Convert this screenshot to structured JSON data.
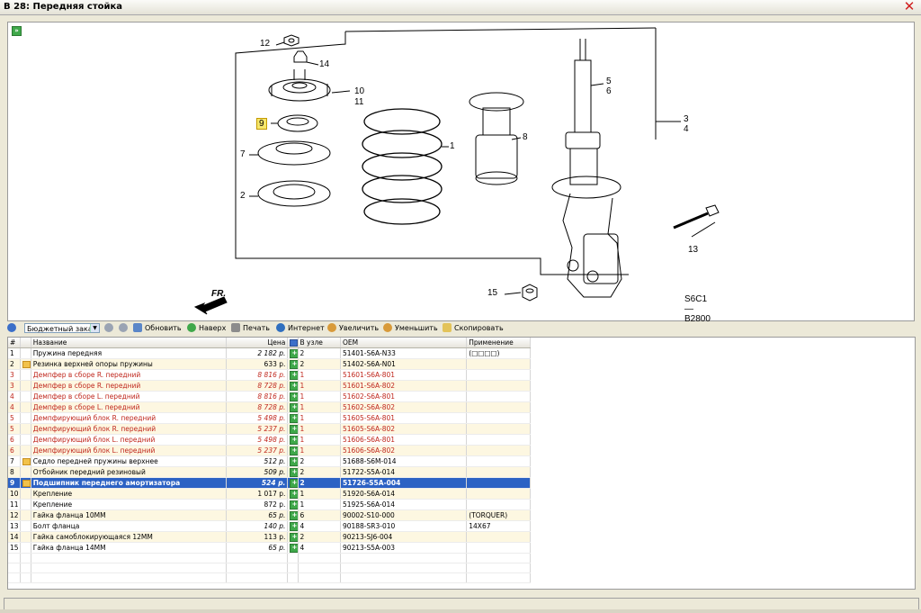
{
  "window": {
    "title": "В 28: Передняя стойка"
  },
  "diagram": {
    "callouts": [
      "12",
      "14",
      "10",
      "11",
      "9",
      "7",
      "2",
      "1",
      "8",
      "5",
      "6",
      "3",
      "4",
      "13",
      "15"
    ],
    "direction_label": "FR.",
    "code": "S6C1— B2800"
  },
  "toolbar": {
    "dropdown_value": "Бюджетный зака",
    "refresh": "Обновить",
    "up": "Наверх",
    "print": "Печать",
    "internet": "Интернет",
    "zoom_in": "Увеличить",
    "zoom_out": "Уменьшить",
    "copy": "Скопировать"
  },
  "columns": {
    "num": "#",
    "name": "Название",
    "price": "Цена",
    "qty": "В узле",
    "oem": "OEM",
    "app": "Применение"
  },
  "rows": [
    {
      "num": "1",
      "name": "Пружина передняя",
      "price": "2 182 р.",
      "qty": "2",
      "oem": "51401-S6A-N33",
      "app": "(□□□□)"
    },
    {
      "num": "2",
      "name": "Резинка верхней опоры пружины",
      "price": "633 р.",
      "qty": "2",
      "oem": "51402-S6A-N01",
      "app": ""
    },
    {
      "num": "3",
      "name": "Демпфер в сборе R. передний",
      "price": "8 816 р.",
      "qty": "1",
      "oem": "51601-S6A-801",
      "app": ""
    },
    {
      "num": "3",
      "name": "Демпфер в сборе R. передний",
      "price": "8 728 р.",
      "qty": "1",
      "oem": "51601-S6A-802",
      "app": ""
    },
    {
      "num": "4",
      "name": "Демпфер в сборе L. передний",
      "price": "8 816 р.",
      "qty": "1",
      "oem": "51602-S6A-801",
      "app": ""
    },
    {
      "num": "4",
      "name": "Демпфер в сборе L. передний",
      "price": "8 728 р.",
      "qty": "1",
      "oem": "51602-S6A-802",
      "app": ""
    },
    {
      "num": "5",
      "name": "Демпфирующий блок R. передний",
      "price": "5 498 р.",
      "qty": "1",
      "oem": "51605-S6A-801",
      "app": ""
    },
    {
      "num": "5",
      "name": "Демпфирующий блок R. передний",
      "price": "5 237 р.",
      "qty": "1",
      "oem": "51605-S6A-802",
      "app": ""
    },
    {
      "num": "6",
      "name": "Демпфирующий блок L. передний",
      "price": "5 498 р.",
      "qty": "1",
      "oem": "51606-S6A-801",
      "app": ""
    },
    {
      "num": "6",
      "name": "Демпфирующий блок L. передний",
      "price": "5 237 р.",
      "qty": "1",
      "oem": "51606-S6A-802",
      "app": ""
    },
    {
      "num": "7",
      "name": "Седло передней пружины верхнее",
      "price": "512 р.",
      "qty": "2",
      "oem": "51688-S6M-014",
      "app": ""
    },
    {
      "num": "8",
      "name": "Отбойник передний резиновый",
      "price": "509 р.",
      "qty": "2",
      "oem": "51722-S5A-014",
      "app": ""
    },
    {
      "num": "9",
      "name": "Подшипник переднего амортизатора",
      "price": "524 р.",
      "qty": "2",
      "oem": "51726-S5A-004",
      "app": ""
    },
    {
      "num": "10",
      "name": "Крепление",
      "price": "1 017 р.",
      "qty": "1",
      "oem": "51920-S6A-014",
      "app": ""
    },
    {
      "num": "11",
      "name": "Крепление",
      "price": "872 р.",
      "qty": "1",
      "oem": "51925-S6A-014",
      "app": ""
    },
    {
      "num": "12",
      "name": "Гайка фланца 10ММ",
      "price": "65 р.",
      "qty": "6",
      "oem": "90002-S10-000",
      "app": "(TORQUER)"
    },
    {
      "num": "13",
      "name": "Болт фланца",
      "price": "140 р.",
      "qty": "4",
      "oem": "90188-SR3-010",
      "app": "14X67"
    },
    {
      "num": "14",
      "name": "Гайка самоблокирующаяся 12ММ",
      "price": "113 р.",
      "qty": "2",
      "oem": "90213-SJ6-004",
      "app": ""
    },
    {
      "num": "15",
      "name": "Гайка фланца 14ММ",
      "price": "65 р.",
      "qty": "4",
      "oem": "90213-S5A-003",
      "app": ""
    }
  ],
  "colors": {
    "selected_row": "#2c62c4",
    "red_text": "#c0281e",
    "alt_row": "#fdf7e1",
    "add_icon": "#3fa84a"
  }
}
